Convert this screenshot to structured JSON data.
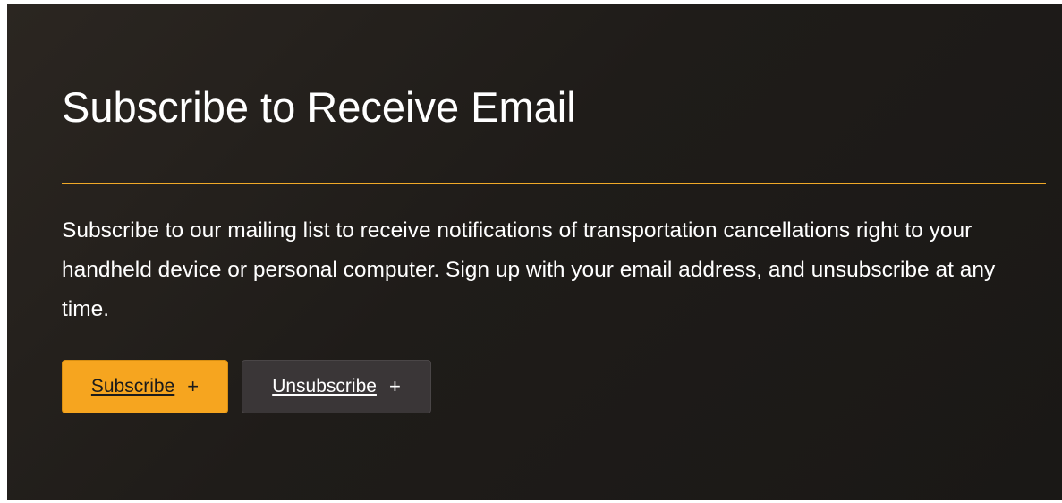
{
  "section": {
    "title": "Subscribe to Receive Email",
    "description": "Subscribe to our mailing list to receive notifications of transportation cancellations right to your handheld device or personal computer. Sign up with your email address, and unsubscribe at any time."
  },
  "buttons": {
    "subscribe": {
      "label": "Subscribe",
      "icon": "+"
    },
    "unsubscribe": {
      "label": "Unsubscribe",
      "icon": "+"
    }
  },
  "colors": {
    "accent": "#f6a51f",
    "divider": "#f0a928",
    "panel_background": "#1f1c19",
    "secondary_button": "#3a3637",
    "text": "#ffffff"
  }
}
